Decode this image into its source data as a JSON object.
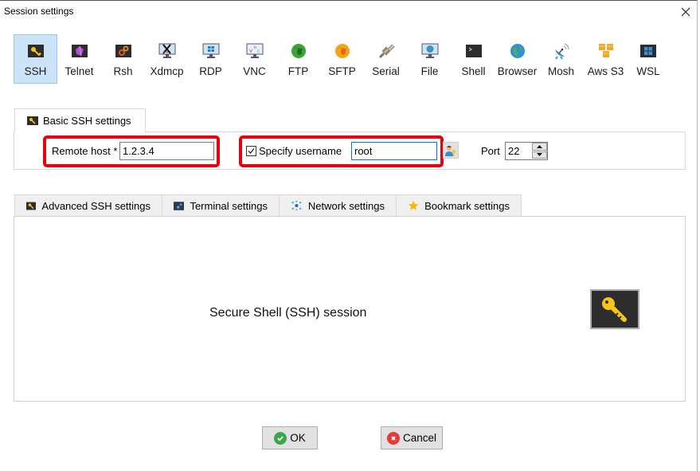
{
  "window": {
    "title": "Session settings",
    "close_icon": "close-icon"
  },
  "session_types": [
    {
      "label": "SSH",
      "icon": "key-icon",
      "active": true
    },
    {
      "label": "Telnet",
      "icon": "telnet-gem-icon",
      "active": false
    },
    {
      "label": "Rsh",
      "icon": "gears-icon",
      "active": false
    },
    {
      "label": "Xdmcp",
      "icon": "x-monitor-icon",
      "active": false
    },
    {
      "label": "RDP",
      "icon": "windows-monitor-icon",
      "active": false
    },
    {
      "label": "VNC",
      "icon": "vnc-monitor-icon",
      "active": false
    },
    {
      "label": "FTP",
      "icon": "green-globe-icon",
      "active": false
    },
    {
      "label": "SFTP",
      "icon": "orange-globe-icon",
      "active": false
    },
    {
      "label": "Serial",
      "icon": "plug-icon",
      "active": false
    },
    {
      "label": "File",
      "icon": "globe-monitor-icon",
      "active": false
    },
    {
      "label": "Shell",
      "icon": "terminal-icon",
      "active": false
    },
    {
      "label": "Browser",
      "icon": "earth-icon",
      "active": false
    },
    {
      "label": "Mosh",
      "icon": "satellite-dish-icon",
      "active": false
    },
    {
      "label": "Aws S3",
      "icon": "cubes-icon",
      "active": false
    },
    {
      "label": "WSL",
      "icon": "windows-logo-icon",
      "active": false
    }
  ],
  "basic": {
    "tab_label": "Basic SSH settings",
    "remote_host_label": "Remote host *",
    "remote_host_value": "1.2.3.4",
    "specify_username_label": "Specify username",
    "specify_username_checked": true,
    "username_value": "root",
    "port_label": "Port",
    "port_value": "22"
  },
  "tabs": [
    {
      "label": "Advanced SSH settings",
      "icon": "key-icon"
    },
    {
      "label": "Terminal settings",
      "icon": "terminal-settings-icon"
    },
    {
      "label": "Network settings",
      "icon": "network-icon"
    },
    {
      "label": "Bookmark settings",
      "icon": "star-icon"
    }
  ],
  "content": {
    "description": "Secure Shell (SSH) session"
  },
  "buttons": {
    "ok": "OK",
    "cancel": "Cancel"
  },
  "colors": {
    "highlight": "#e8000d",
    "active_type_bg": "#cce4f7",
    "key_yellow": "#f5c518"
  }
}
